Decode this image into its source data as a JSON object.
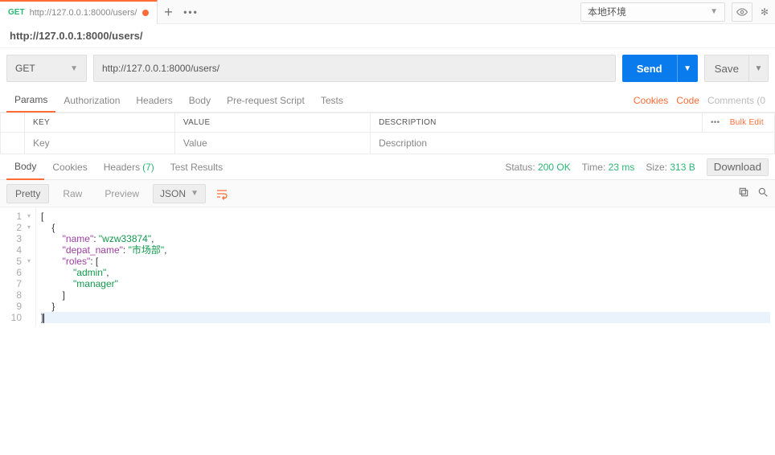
{
  "tab": {
    "method": "GET",
    "url": "http://127.0.0.1:8000/users/"
  },
  "env": {
    "name": "本地环境"
  },
  "address_display": "http://127.0.0.1:8000/users/",
  "request": {
    "method": "GET",
    "url": "http://127.0.0.1:8000/users/",
    "send_label": "Send",
    "save_label": "Save"
  },
  "req_tabs": {
    "params": "Params",
    "authorization": "Authorization",
    "headers": "Headers",
    "body": "Body",
    "prerequest": "Pre-request Script",
    "tests": "Tests"
  },
  "links": {
    "cookies": "Cookies",
    "code": "Code",
    "comments": "Comments (0"
  },
  "params_table": {
    "th_key": "KEY",
    "th_value": "VALUE",
    "th_desc": "DESCRIPTION",
    "bulk_edit": "Bulk Edit",
    "more": "•••",
    "ph_key": "Key",
    "ph_value": "Value",
    "ph_desc": "Description"
  },
  "resp_tabs": {
    "body": "Body",
    "cookies": "Cookies",
    "headers": "Headers",
    "headers_count": "(7)",
    "test_results": "Test Results"
  },
  "resp_meta": {
    "status_label": "Status:",
    "status_value": "200 OK",
    "time_label": "Time:",
    "time_value": "23 ms",
    "size_label": "Size:",
    "size_value": "313 B",
    "download": "Download"
  },
  "resp_toolbar": {
    "pretty": "Pretty",
    "raw": "Raw",
    "preview": "Preview",
    "json": "JSON"
  },
  "response_body": {
    "lines": [
      {
        "n": 1,
        "fold": true,
        "content": [
          {
            "c": "p",
            "t": "["
          }
        ]
      },
      {
        "n": 2,
        "fold": true,
        "content": [
          {
            "c": "p",
            "t": "    {"
          }
        ]
      },
      {
        "n": 3,
        "fold": false,
        "content": [
          {
            "c": "p",
            "t": "        "
          },
          {
            "c": "k",
            "t": "\"name\""
          },
          {
            "c": "p",
            "t": ": "
          },
          {
            "c": "s",
            "t": "\"wzw33874\""
          },
          {
            "c": "p",
            "t": ","
          }
        ]
      },
      {
        "n": 4,
        "fold": false,
        "content": [
          {
            "c": "p",
            "t": "        "
          },
          {
            "c": "k",
            "t": "\"depat_name\""
          },
          {
            "c": "p",
            "t": ": "
          },
          {
            "c": "s",
            "t": "\"市场部\""
          },
          {
            "c": "p",
            "t": ","
          }
        ]
      },
      {
        "n": 5,
        "fold": true,
        "content": [
          {
            "c": "p",
            "t": "        "
          },
          {
            "c": "k",
            "t": "\"roles\""
          },
          {
            "c": "p",
            "t": ": ["
          }
        ]
      },
      {
        "n": 6,
        "fold": false,
        "content": [
          {
            "c": "p",
            "t": "            "
          },
          {
            "c": "s",
            "t": "\"admin\""
          },
          {
            "c": "p",
            "t": ","
          }
        ]
      },
      {
        "n": 7,
        "fold": false,
        "content": [
          {
            "c": "p",
            "t": "            "
          },
          {
            "c": "s",
            "t": "\"manager\""
          }
        ]
      },
      {
        "n": 8,
        "fold": false,
        "content": [
          {
            "c": "p",
            "t": "        ]"
          }
        ]
      },
      {
        "n": 9,
        "fold": false,
        "content": [
          {
            "c": "p",
            "t": "    }"
          }
        ]
      },
      {
        "n": 10,
        "fold": false,
        "hl": true,
        "caret": true,
        "content": [
          {
            "c": "p",
            "t": "]"
          }
        ]
      }
    ]
  }
}
